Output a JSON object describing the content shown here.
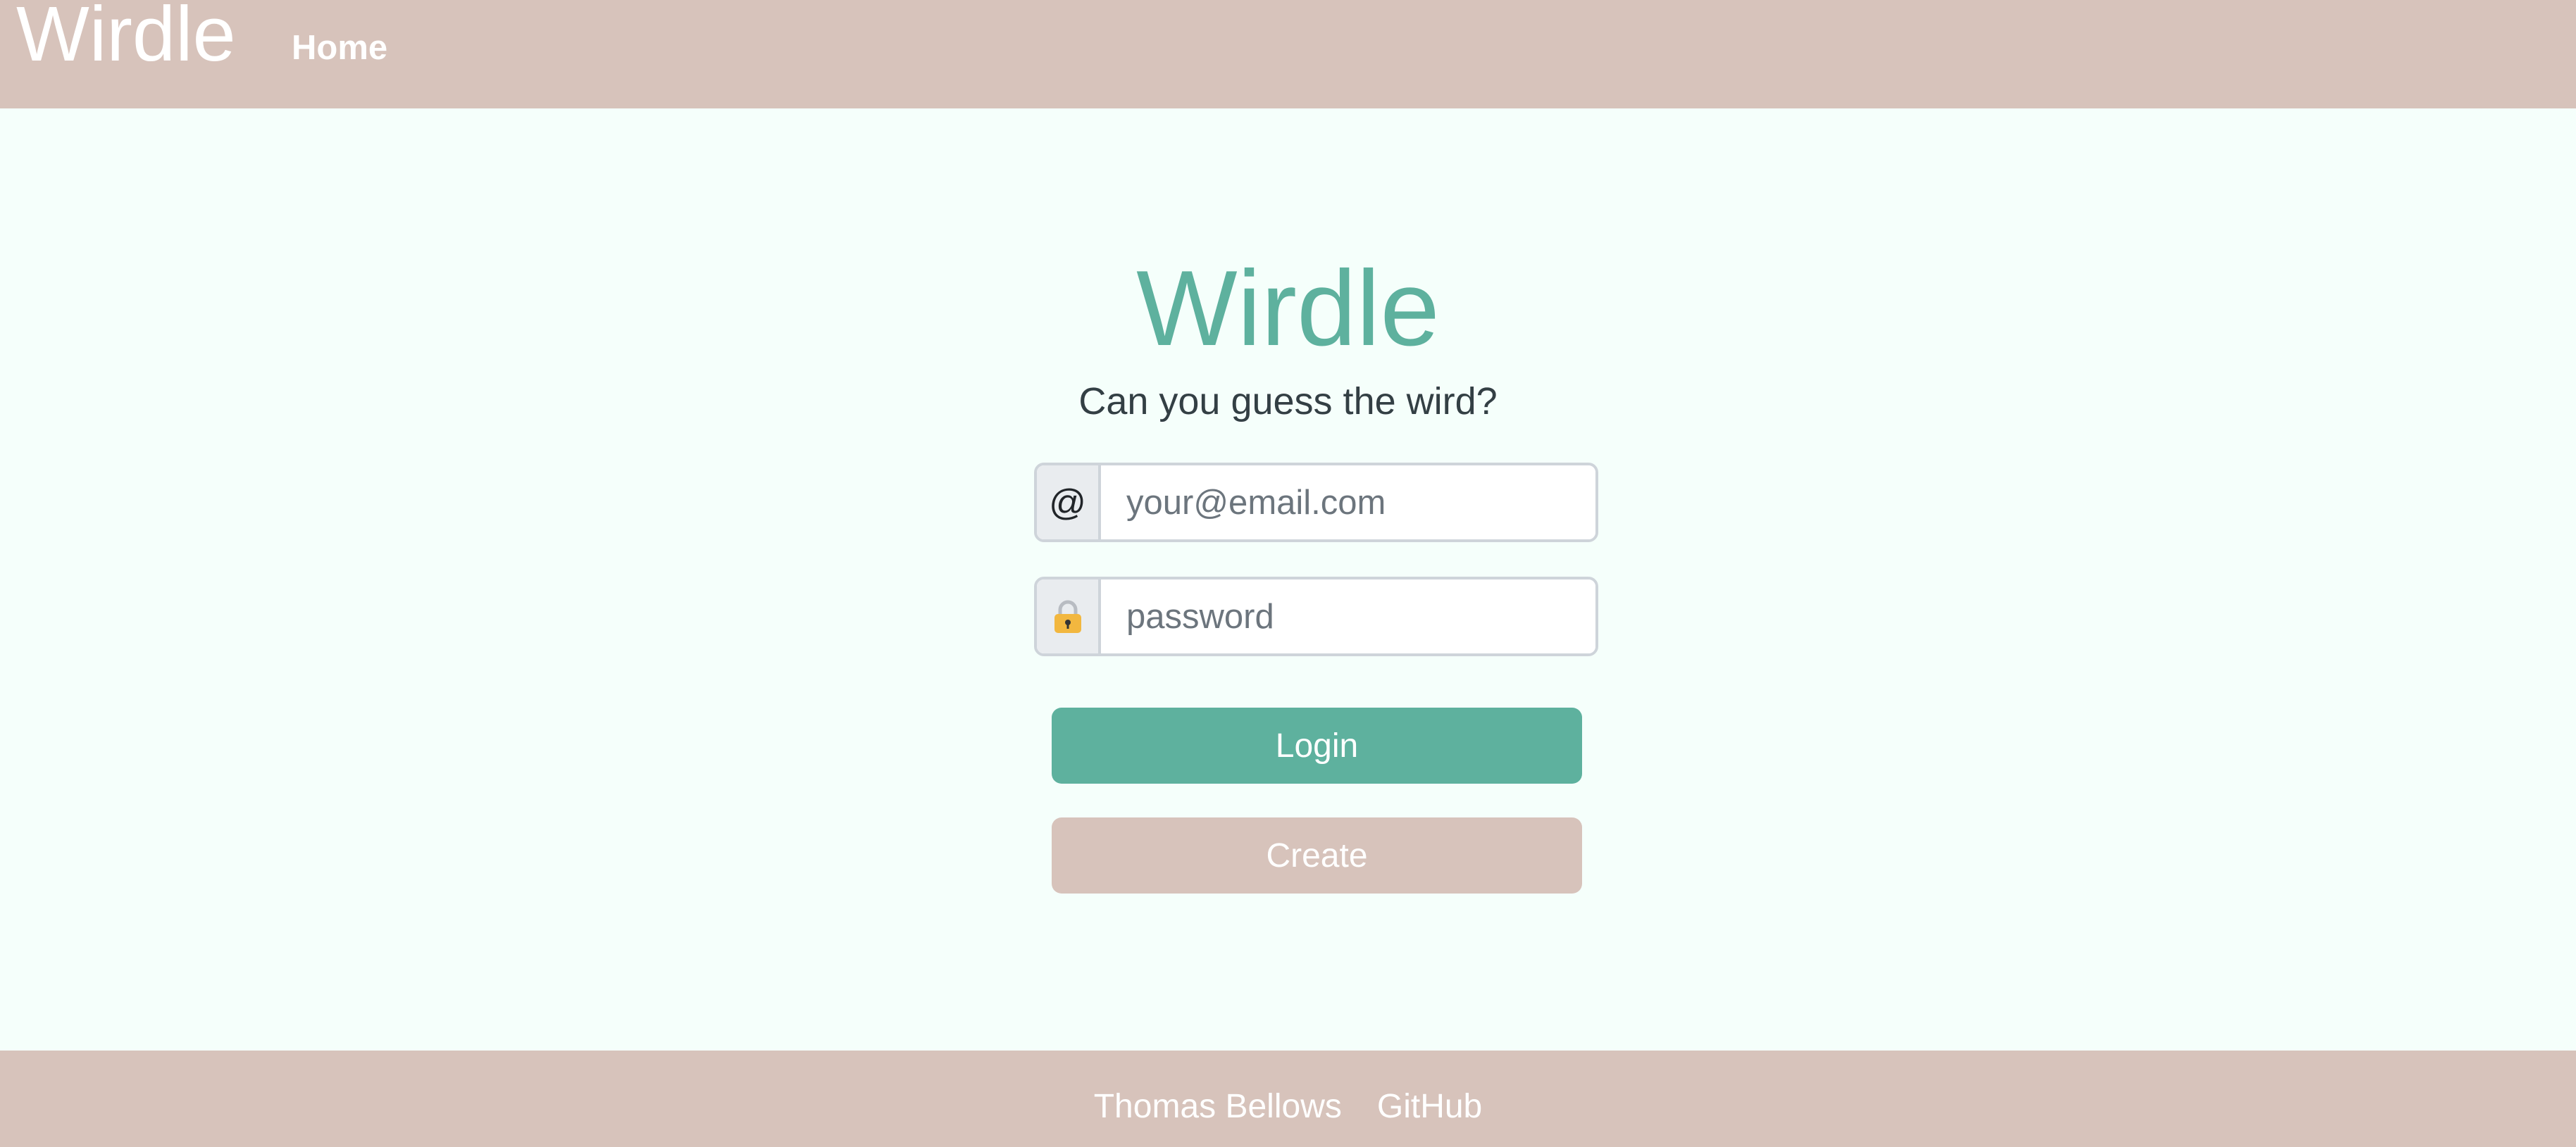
{
  "header": {
    "brand": "Wirdle",
    "nav": [
      {
        "label": "Home"
      }
    ]
  },
  "login": {
    "title": "Wirdle",
    "subtitle": "Can you guess the wird?",
    "email": {
      "addon": "@",
      "value": "",
      "placeholder": "your@email.com"
    },
    "password": {
      "icon": "lock-icon",
      "value": "",
      "placeholder": "password"
    },
    "login_label": "Login",
    "create_label": "Create"
  },
  "footer": {
    "links": [
      {
        "label": "Thomas Bellows"
      },
      {
        "label": "GitHub"
      }
    ]
  },
  "colors": {
    "nav_background": "#D7C3BB",
    "page_background": "#F5FFFB",
    "accent": "#5EB19E",
    "create_button": "#D7C3BB",
    "lock": "#F2B73F"
  }
}
